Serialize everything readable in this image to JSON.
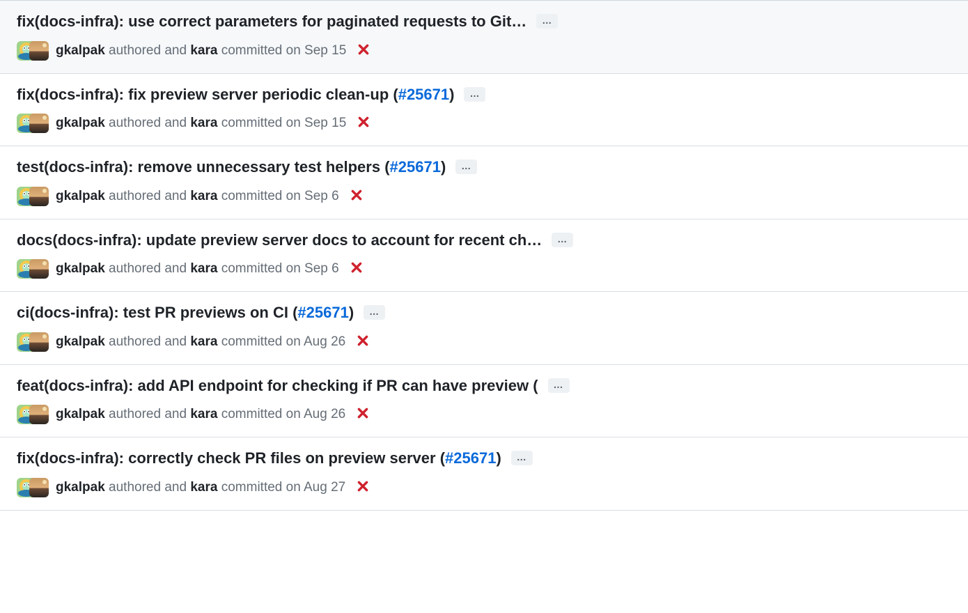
{
  "pr_ref": "#25671",
  "ellipsis_label": "…",
  "meta_words": {
    "authored_and": "authored and",
    "committed": "committed"
  },
  "commits": [
    {
      "title_prefix": "fix(docs-infra): use correct parameters for paginated requests to Git",
      "title_truncated": true,
      "pr_link": null,
      "trailing_paren": false,
      "author": "gkalpak",
      "committer": "kara",
      "date": "on Sep 15",
      "status": "fail",
      "hovered": true
    },
    {
      "title_prefix": "fix(docs-infra): fix preview server periodic clean-up ",
      "title_truncated": false,
      "pr_link": "#25671",
      "trailing_paren": true,
      "author": "gkalpak",
      "committer": "kara",
      "date": "on Sep 15",
      "status": "fail",
      "hovered": false
    },
    {
      "title_prefix": "test(docs-infra): remove unnecessary test helpers ",
      "title_truncated": false,
      "pr_link": "#25671",
      "trailing_paren": true,
      "author": "gkalpak",
      "committer": "kara",
      "date": "on Sep 6",
      "status": "fail",
      "hovered": false
    },
    {
      "title_prefix": "docs(docs-infra): update preview server docs to account for recent ch",
      "title_truncated": true,
      "pr_link": null,
      "trailing_paren": false,
      "author": "gkalpak",
      "committer": "kara",
      "date": "on Sep 6",
      "status": "fail",
      "hovered": false
    },
    {
      "title_prefix": "ci(docs-infra): test PR previews on CI ",
      "title_truncated": false,
      "pr_link": "#25671",
      "trailing_paren": true,
      "author": "gkalpak",
      "committer": "kara",
      "date": "on Aug 26",
      "status": "fail",
      "hovered": false
    },
    {
      "title_prefix": "feat(docs-infra): add API endpoint for checking if PR can have preview (",
      "title_truncated": false,
      "pr_link": null,
      "trailing_paren": false,
      "author": "gkalpak",
      "committer": "kara",
      "date": "on Aug 26",
      "status": "fail",
      "hovered": false
    },
    {
      "title_prefix": "fix(docs-infra): correctly check PR files on preview server ",
      "title_truncated": false,
      "pr_link": "#25671",
      "trailing_paren": true,
      "author": "gkalpak",
      "committer": "kara",
      "date": "on Aug 27",
      "status": "fail",
      "hovered": false
    }
  ]
}
